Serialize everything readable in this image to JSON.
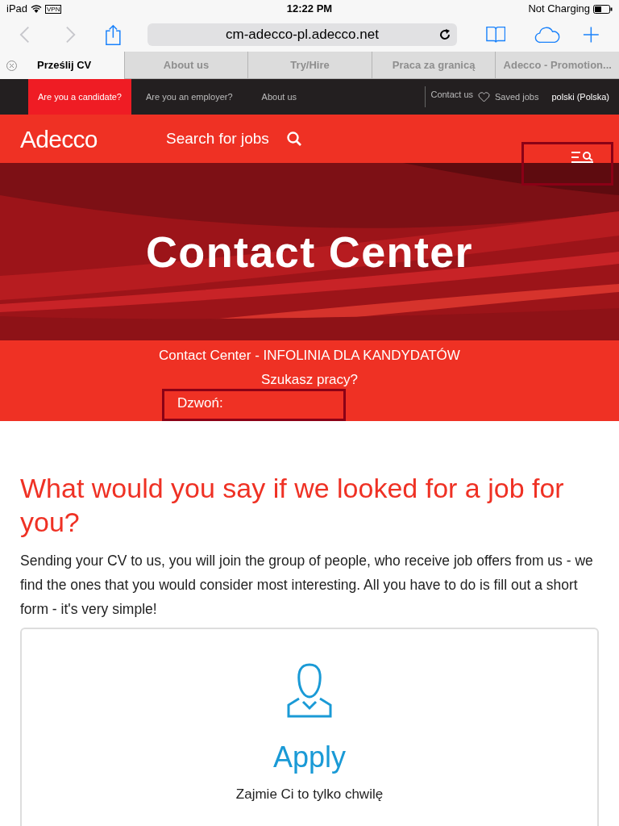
{
  "status_bar": {
    "device": "iPad",
    "vpn": "VPN",
    "time": "12:22 PM",
    "battery": "Not Charging"
  },
  "browser": {
    "url": "cm-adecco-pl.adecco.net"
  },
  "tabs": [
    {
      "label": "Prześlij CV",
      "selected": true
    },
    {
      "label": "About us",
      "selected": false
    },
    {
      "label": "Try/Hire",
      "selected": false
    },
    {
      "label": "Praca za granicą",
      "selected": false
    },
    {
      "label": "Adecco - Promotion...",
      "selected": false
    }
  ],
  "top_nav": {
    "items": [
      {
        "label": "Are you a candidate?",
        "selected": true
      },
      {
        "label": "Are you an employer?",
        "selected": false
      },
      {
        "label": "About us",
        "selected": false
      }
    ],
    "contact": "Contact us",
    "saved": "Saved jobs",
    "language": "polski (Polska)"
  },
  "header": {
    "logo": "Adecco",
    "search": "Search for jobs"
  },
  "hero": {
    "title": "Contact Center"
  },
  "info": {
    "lines": [
      "Contact Center - INFOLINIA DLA KANDYDATÓW",
      "Szukasz pracy?",
      "Dzwoń:"
    ]
  },
  "content": {
    "heading": "What would you say if we looked for a job for you?",
    "text": "Sending your CV to us, you will join the group of people, who receive job offers from us - we find the ones that you would consider most interesting. All you have to do is fill out a short form - it's very simple!"
  },
  "card": {
    "title": "Apply",
    "subtitle": "Zajmie Ci to tylko chwilę"
  }
}
